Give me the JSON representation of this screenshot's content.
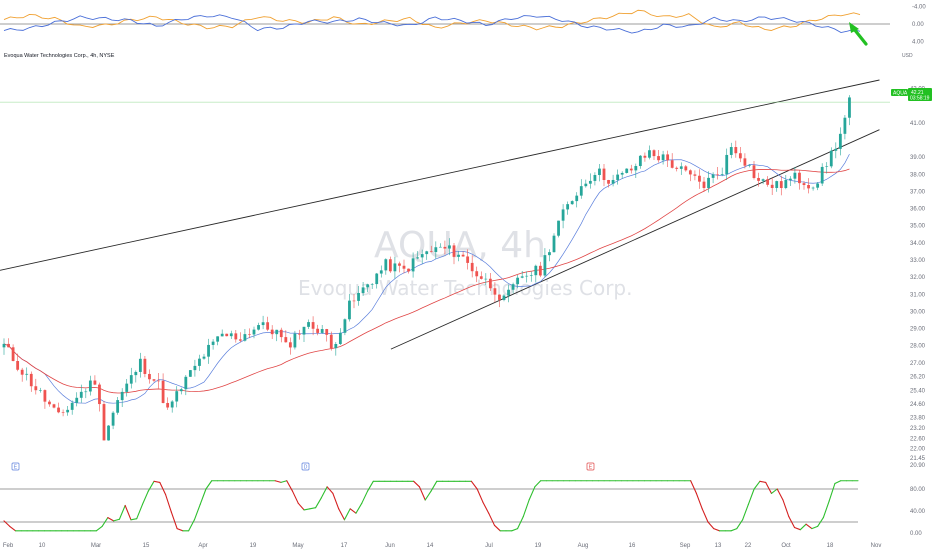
{
  "header": {
    "title": "Evoqua Water Technologies Corp., 4h, NYSE",
    "currency": "USD",
    "symbol_tag": "AQUA",
    "last_price": "42.21",
    "change_label": "03:58:19"
  },
  "watermark": {
    "symbol": "AQUA, 4h",
    "name": "Evoqua Water Technologies Corp."
  },
  "event_markers": [
    "E",
    "D",
    "E"
  ],
  "colors": {
    "up_candle": "#26a69a",
    "down_candle": "#ef5350",
    "sma_fast": "#5b7fdc",
    "sma_slow": "#e04545",
    "trendline": "#2a2a2a",
    "osc_blue": "#4a6fd8",
    "osc_orange": "#f0a030",
    "stoch_up": "#2fbf2f",
    "stoch_down": "#d42020",
    "arrow": "#22c022",
    "price_tag": "#22c022"
  },
  "chart_data": [
    {
      "panel": "top-oscillator",
      "type": "line",
      "y_ticks": [
        "-4.00",
        "0.00",
        "4.00"
      ],
      "ylim": [
        -5,
        5
      ],
      "reference_line": 0,
      "series": [
        {
          "values": [
            1.0,
            2.0,
            1.2,
            -0.6,
            -0.3,
            0.9,
            1.6,
            0.3,
            -0.8,
            -0.5,
            1.7,
            0.8,
            0.4,
            1.5,
            -0.2,
            0.6,
            1.2,
            -0.9,
            0.2,
            0.8,
            -0.2,
            -1.0,
            -0.5,
            0.7,
            1.8,
            3.0,
            1.6,
            2.0,
            -0.8,
            0.3,
            -1.3,
            -0.6,
            1.0,
            2.2
          ]
        },
        {
          "values": [
            -1.5,
            -1.0,
            0.3,
            1.5,
            1.2,
            0.8,
            -0.5,
            1.1,
            1.9,
            1.6,
            -1.2,
            -0.8,
            0.6,
            0.5,
            1.1,
            0.2,
            -0.4,
            1.4,
            0.8,
            -0.2,
            1.3,
            1.9,
            0.9,
            -0.6,
            -1.2,
            -1.9,
            -0.3,
            -0.6,
            1.2,
            0.6,
            1.5,
            1.0,
            -0.2,
            -1.6
          ]
        }
      ]
    },
    {
      "panel": "price",
      "type": "candlestick",
      "ylim": [
        21.8,
        43.5
      ],
      "y_ticks": [
        "43.00",
        "42.21",
        "41.00",
        "39.00",
        "38.00",
        "37.00",
        "36.00",
        "35.00",
        "34.00",
        "33.00",
        "32.00",
        "31.00",
        "30.00",
        "29.00",
        "28.00",
        "27.00",
        "26.20",
        "25.40",
        "24.60",
        "23.80",
        "23.20",
        "22.60",
        "22.00",
        "21.45"
      ],
      "last_price": 42.21,
      "x_labels": [
        "Feb",
        "10",
        "Mar",
        "15",
        "Apr",
        "19",
        "May",
        "17",
        "Jun",
        "14",
        "Jul",
        "19",
        "Aug",
        "16",
        "Sep",
        "13",
        "22",
        "Oct",
        "18",
        "Nov"
      ],
      "anchors": [
        [
          0,
          28.0
        ],
        [
          4,
          26.5
        ],
        [
          8,
          25.2
        ],
        [
          12,
          23.8
        ],
        [
          16,
          25.0
        ],
        [
          20,
          26.0
        ],
        [
          22,
          22.8
        ],
        [
          25,
          24.8
        ],
        [
          30,
          27.0
        ],
        [
          34,
          25.7
        ],
        [
          36,
          24.2
        ],
        [
          40,
          26.0
        ],
        [
          44,
          27.5
        ],
        [
          48,
          28.6
        ],
        [
          52,
          28.5
        ],
        [
          56,
          29.2
        ],
        [
          60,
          28.8
        ],
        [
          62,
          27.9
        ],
        [
          66,
          29.2
        ],
        [
          70,
          29.0
        ],
        [
          72,
          27.8
        ],
        [
          76,
          30.3
        ],
        [
          80,
          31.6
        ],
        [
          84,
          32.7
        ],
        [
          88,
          32.4
        ],
        [
          92,
          33.3
        ],
        [
          96,
          33.7
        ],
        [
          100,
          33.4
        ],
        [
          104,
          32.2
        ],
        [
          108,
          31.3
        ],
        [
          110,
          30.6
        ],
        [
          114,
          32.1
        ],
        [
          118,
          32.4
        ],
        [
          122,
          35.2
        ],
        [
          126,
          37.0
        ],
        [
          130,
          38.2
        ],
        [
          134,
          37.6
        ],
        [
          138,
          38.3
        ],
        [
          142,
          39.3
        ],
        [
          146,
          38.8
        ],
        [
          150,
          38.0
        ],
        [
          154,
          37.4
        ],
        [
          158,
          38.3
        ],
        [
          160,
          39.6
        ],
        [
          162,
          39.2
        ],
        [
          166,
          37.6
        ],
        [
          170,
          37.3
        ],
        [
          174,
          37.8
        ],
        [
          178,
          37.4
        ],
        [
          180,
          38.1
        ],
        [
          184,
          40.3
        ],
        [
          186,
          42.2
        ]
      ],
      "series": [
        {
          "name": "",
          "kind": "sma-fast"
        },
        {
          "name": "",
          "kind": "sma-slow"
        }
      ],
      "trendlines": [
        {
          "from": [
            0,
            32.4
          ],
          "to": [
            186,
            42.9
          ]
        },
        {
          "from": [
            86,
            27.8
          ],
          "to": [
            186,
            39.6
          ]
        }
      ]
    },
    {
      "panel": "stochastic",
      "type": "line",
      "ylim": [
        0,
        100
      ],
      "y_ticks": [
        "20.90",
        "80.00",
        "40.00",
        "0.00"
      ],
      "levels": [
        80,
        20
      ],
      "values": [
        22,
        12,
        4,
        4,
        4,
        4,
        4,
        4,
        4,
        4,
        4,
        4,
        4,
        4,
        4,
        4,
        4,
        12,
        28,
        22,
        25,
        50,
        24,
        26,
        52,
        76,
        94,
        92,
        70,
        38,
        8,
        4,
        4,
        24,
        52,
        80,
        95,
        95,
        95,
        95,
        95,
        95,
        95,
        95,
        95,
        95,
        95,
        95,
        92,
        95,
        76,
        54,
        42,
        44,
        46,
        64,
        84,
        72,
        44,
        24,
        44,
        36,
        54,
        76,
        94,
        94,
        94,
        94,
        94,
        94,
        94,
        94,
        84,
        60,
        76,
        94,
        94,
        94,
        94,
        94,
        94,
        94,
        80,
        56,
        36,
        14,
        4,
        4,
        4,
        8,
        30,
        60,
        84,
        95,
        95,
        95,
        95,
        95,
        95,
        95,
        95,
        95,
        95,
        95,
        95,
        95,
        95,
        95,
        95,
        95,
        95,
        95,
        95,
        95,
        95,
        95,
        95,
        95,
        95,
        95,
        72,
        44,
        20,
        8,
        4,
        4,
        4,
        8,
        24,
        52,
        80,
        94,
        92,
        72,
        80,
        60,
        30,
        10,
        6,
        16,
        8,
        12,
        28,
        58,
        90,
        95,
        95,
        95,
        95
      ]
    }
  ]
}
